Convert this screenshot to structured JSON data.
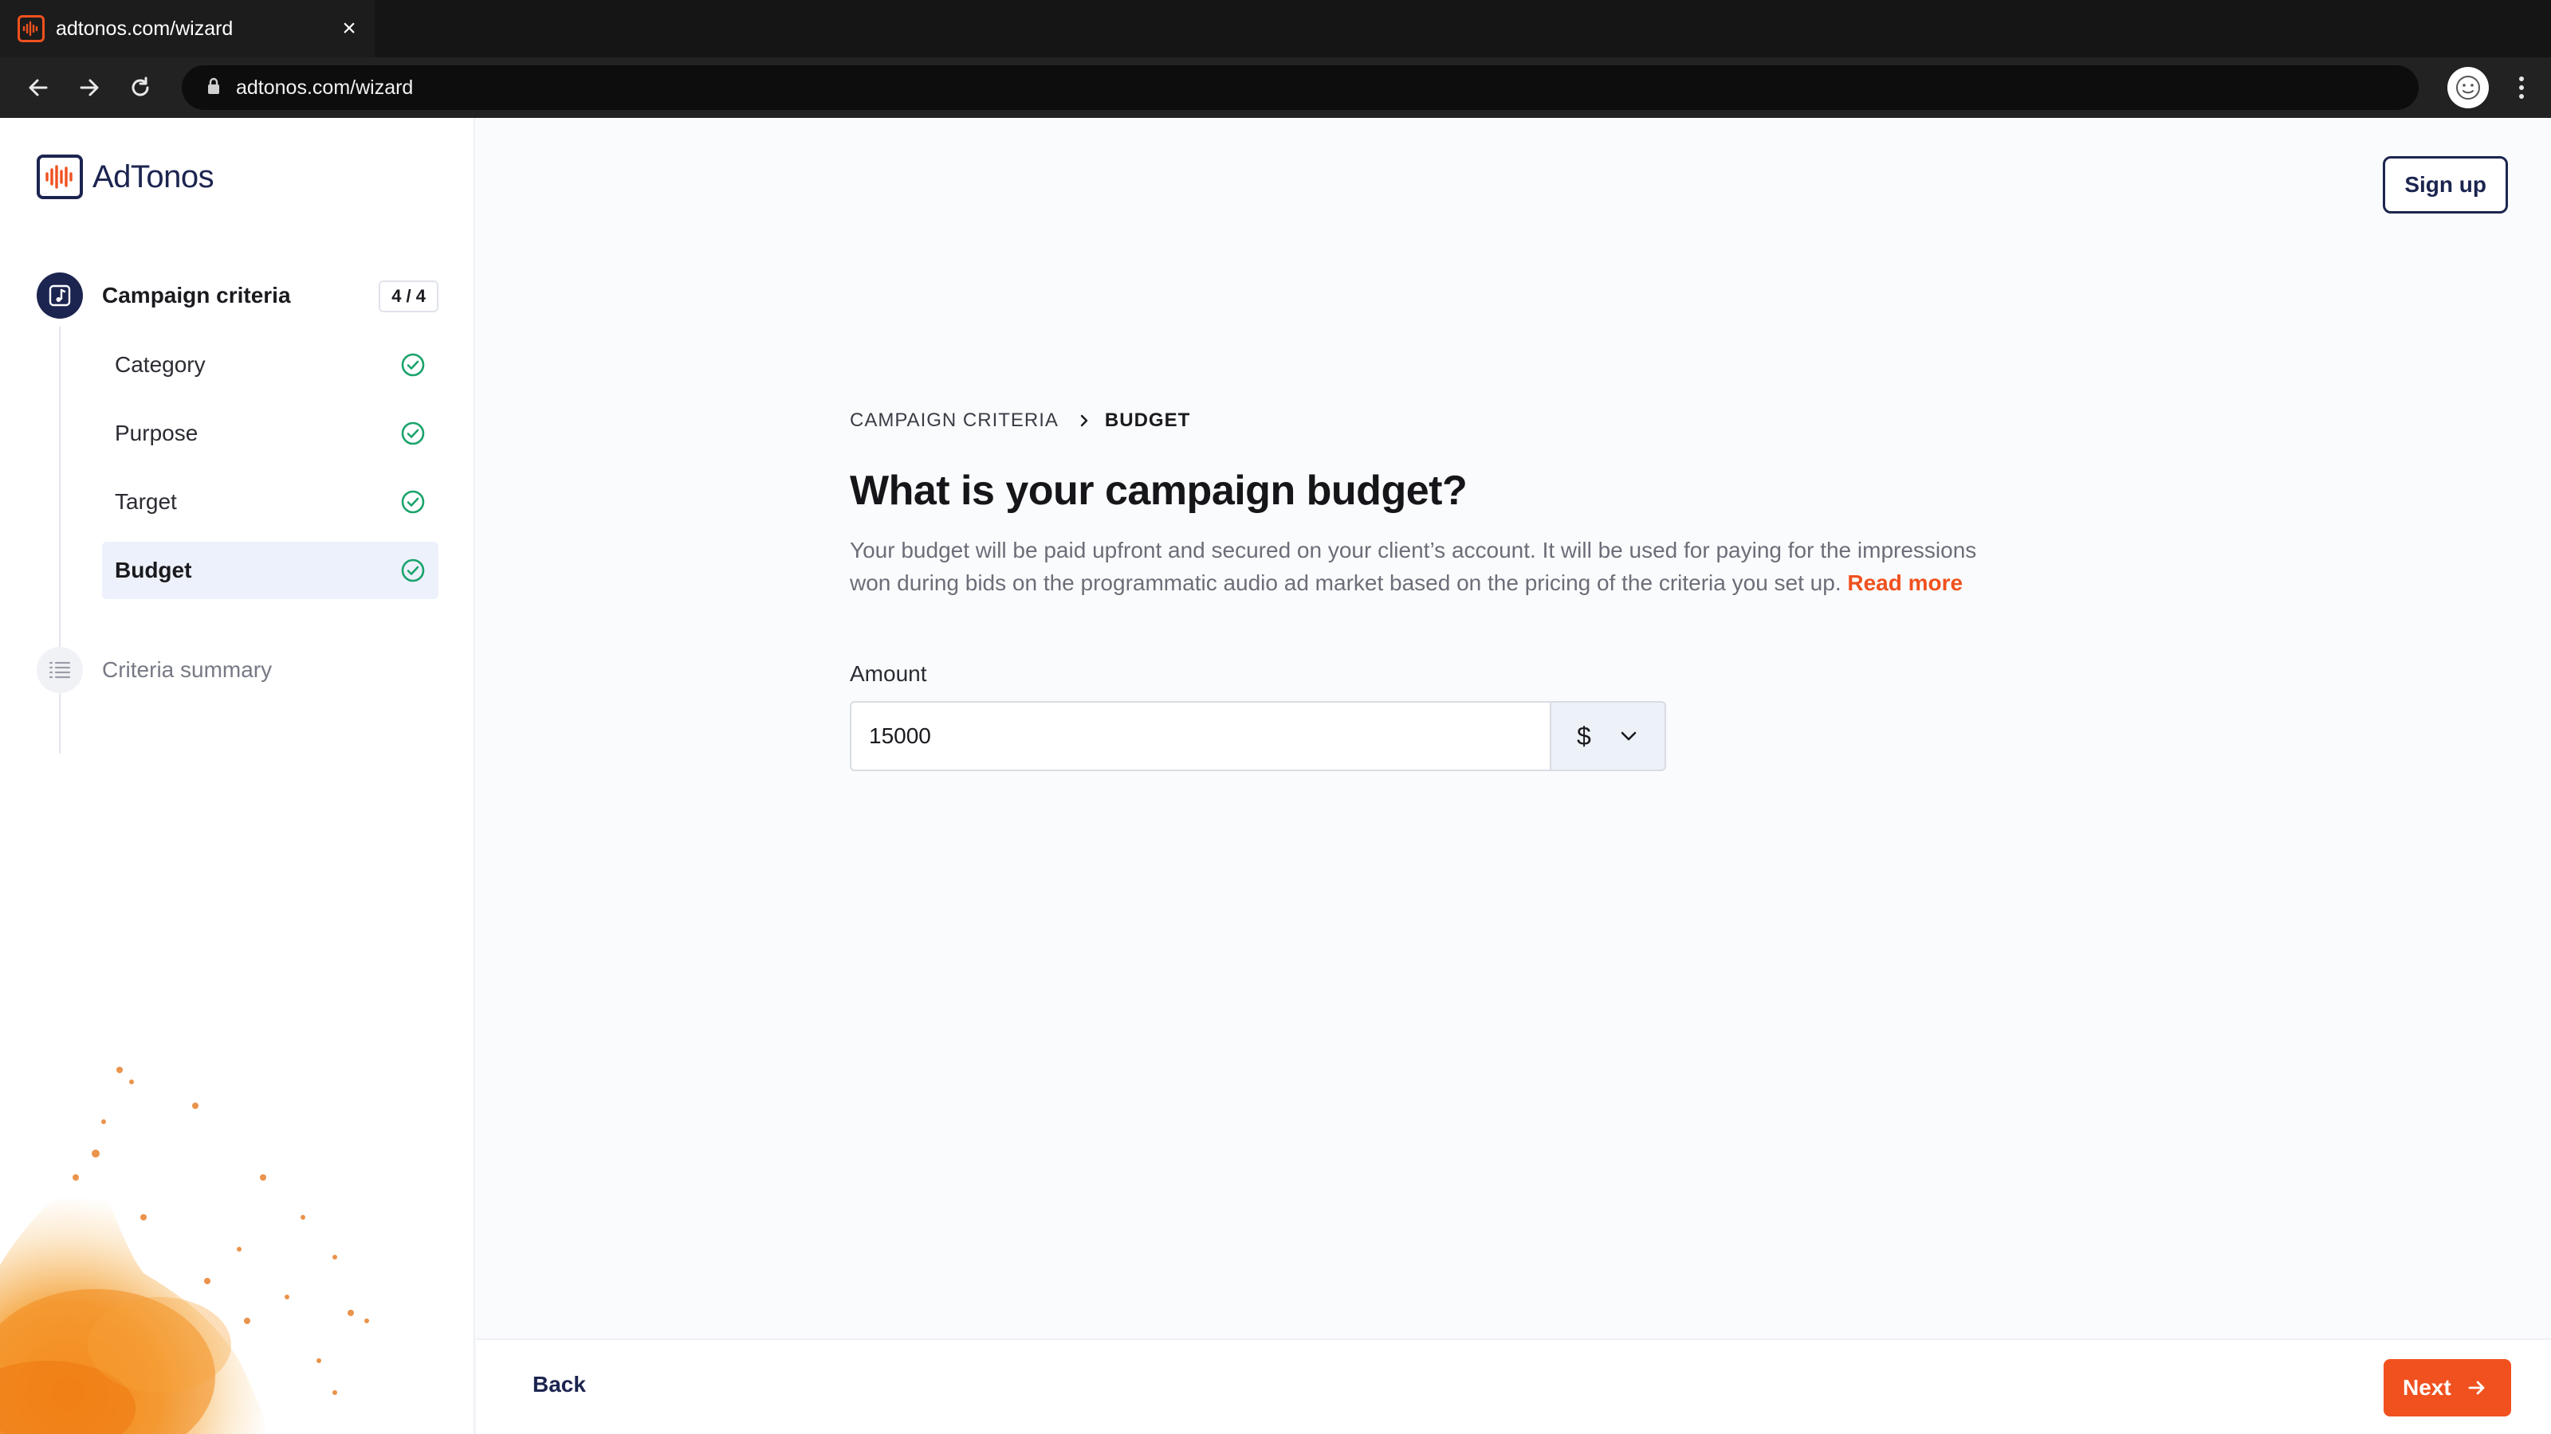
{
  "browser": {
    "tab_title": "adtonos.com/wizard",
    "url": "adtonos.com/wizard",
    "icons": [
      "back-arrow-icon",
      "forward-arrow-icon",
      "reload-icon",
      "lock-icon",
      "close-icon",
      "kebab-menu-icon"
    ]
  },
  "brand": {
    "name": "AdTonos",
    "accent_color": "#f0511e",
    "navy_color": "#1c2550"
  },
  "sidebar": {
    "main_step": {
      "label": "Campaign criteria",
      "count": "4 / 4"
    },
    "substeps": [
      {
        "label": "Category",
        "done": true
      },
      {
        "label": "Purpose",
        "done": true
      },
      {
        "label": "Target",
        "done": true
      },
      {
        "label": "Budget",
        "done": true,
        "active": true
      }
    ],
    "summary_step": {
      "label": "Criteria summary"
    }
  },
  "header": {
    "signup_label": "Sign up"
  },
  "main": {
    "breadcrumb": [
      "CAMPAIGN CRITERIA",
      "BUDGET"
    ],
    "title": "What is your campaign budget?",
    "description": "Your budget will be paid upfront and secured on your client’s account. It will be used for paying for the impressions won during bids on the programmatic audio ad market based on the pricing of the criteria you set up.",
    "read_more": "Read more",
    "amount_label": "Amount",
    "amount_value": "15000",
    "currency": "$"
  },
  "footer": {
    "back_label": "Back",
    "next_label": "Next"
  }
}
